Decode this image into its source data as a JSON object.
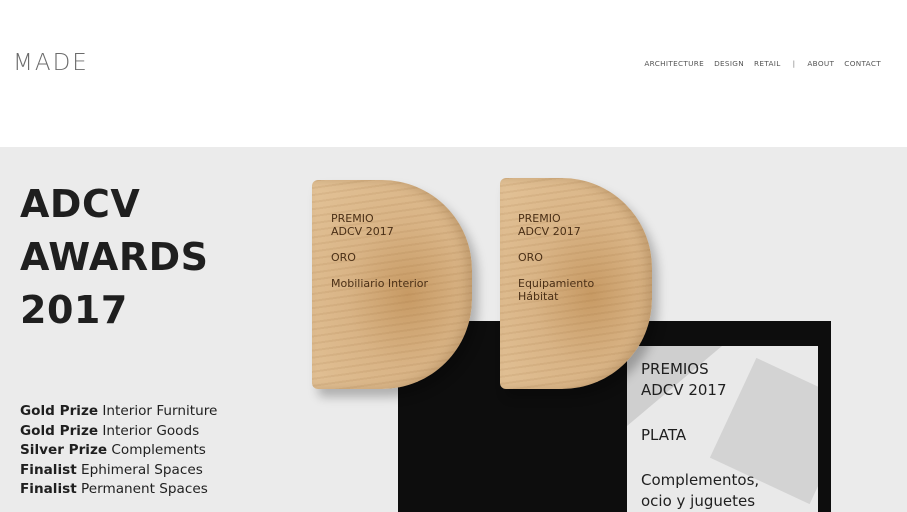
{
  "header": {
    "logo": "MADE",
    "nav": [
      {
        "label": "ARCHITECTURE",
        "name": "nav-architecture"
      },
      {
        "label": "DESIGN",
        "name": "nav-design"
      },
      {
        "label": "RETAIL",
        "name": "nav-retail"
      },
      {
        "label": "|",
        "name": "nav-separator"
      },
      {
        "label": "ABOUT",
        "name": "nav-about"
      },
      {
        "label": "CONTACT",
        "name": "nav-contact"
      }
    ]
  },
  "hero": {
    "title_lines": [
      "ADCV",
      "AWARDS",
      "2017"
    ],
    "awards": [
      {
        "prize": "Gold Prize",
        "category": "Interior Furniture"
      },
      {
        "prize": "Gold Prize",
        "category": "Interior Goods"
      },
      {
        "prize": "Silver Prize",
        "category": "Complements"
      },
      {
        "prize": "Finalist",
        "category": "Ephimeral Spaces"
      },
      {
        "prize": "Finalist",
        "category": "Permanent Spaces"
      }
    ]
  },
  "photo": {
    "plaque_left": {
      "line1": "PREMIO",
      "line2": "ADCV 2017",
      "line3": "ORO",
      "line4": "Mobiliario Interior"
    },
    "plaque_right": {
      "line1": "PREMIO",
      "line2": "ADCV 2017",
      "line3": "ORO",
      "line4": "Equipamiento",
      "line5": "Hábitat"
    },
    "poster": {
      "line1": "PREMIOS",
      "line2": "ADCV 2017",
      "line3": "PLATA",
      "line4": "Complementos,",
      "line5": "ocio y juguetes"
    }
  }
}
